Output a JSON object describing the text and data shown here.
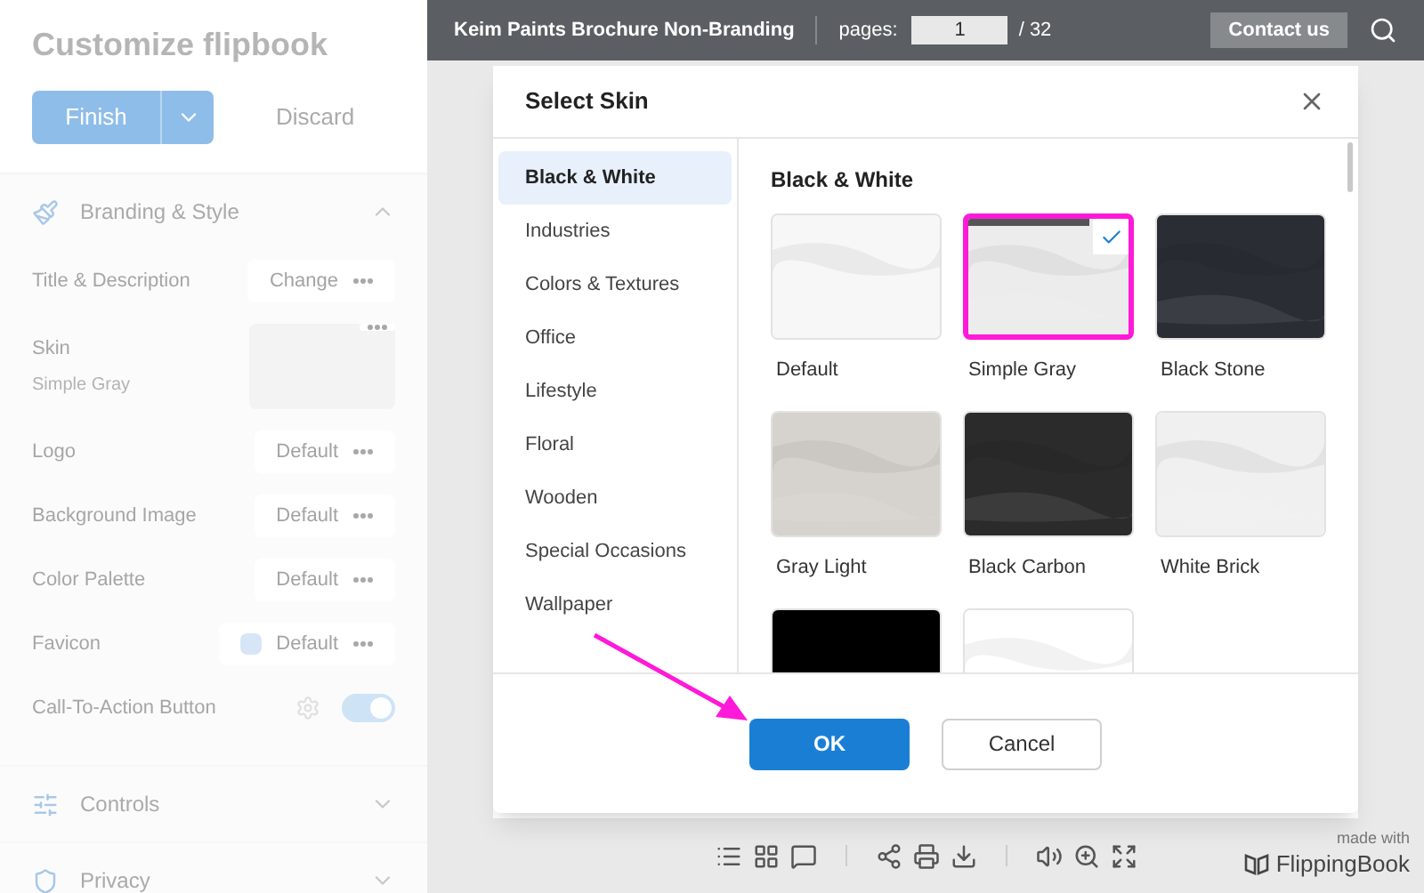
{
  "sidebar": {
    "title": "Customize flipbook",
    "finish_button": "Finish",
    "discard_button": "Discard",
    "sections": [
      {
        "label": "Branding & Style",
        "expanded": true,
        "rows": [
          {
            "kind": "button",
            "label": "Title & Description",
            "button": "Change"
          },
          {
            "kind": "thumbnail",
            "label": "Skin",
            "value": "Simple Gray"
          },
          {
            "kind": "button",
            "label": "Logo",
            "button": "Default"
          },
          {
            "kind": "button",
            "label": "Background Image",
            "button": "Default"
          },
          {
            "kind": "button",
            "label": "Color Palette",
            "button": "Default"
          },
          {
            "kind": "favicon",
            "label": "Favicon",
            "button": "Default"
          },
          {
            "kind": "toggle",
            "label": "Call-To-Action Button",
            "on": true
          }
        ]
      },
      {
        "label": "Controls",
        "expanded": false
      },
      {
        "label": "Privacy",
        "expanded": false
      }
    ]
  },
  "viewer": {
    "title": "Keim Paints Brochure Non-Branding",
    "pages_label": "pages:",
    "page_value": "1",
    "page_total": "/ 32",
    "contact_button": "Contact us",
    "made_with": "made with",
    "brand": "FlippingBook"
  },
  "dialog": {
    "title": "Select Skin",
    "categories": [
      {
        "label": "Black & White",
        "selected": true
      },
      {
        "label": "Industries",
        "selected": false
      },
      {
        "label": "Colors & Textures",
        "selected": false
      },
      {
        "label": "Office",
        "selected": false
      },
      {
        "label": "Lifestyle",
        "selected": false
      },
      {
        "label": "Floral",
        "selected": false
      },
      {
        "label": "Wooden",
        "selected": false
      },
      {
        "label": "Special Occasions",
        "selected": false
      },
      {
        "label": "Wallpaper",
        "selected": false
      }
    ],
    "group_title": "Black & White",
    "skins": [
      {
        "name": "Default",
        "color": "#f7f7f7",
        "selected": false
      },
      {
        "name": "Simple Gray",
        "color": "#ececec",
        "selected": true
      },
      {
        "name": "Black Stone",
        "color": "#2a2d33",
        "selected": false
      },
      {
        "name": "Gray Light",
        "color": "#d6d3cf",
        "selected": false
      },
      {
        "name": "Black Carbon",
        "color": "#2b2b2b",
        "selected": false
      },
      {
        "name": "White Brick",
        "color": "#f0f0f0",
        "selected": false
      },
      {
        "color": "#000000",
        "selected": false
      },
      {
        "color": "#ffffff",
        "selected": false
      }
    ],
    "ok_button": "OK",
    "cancel_button": "Cancel"
  }
}
